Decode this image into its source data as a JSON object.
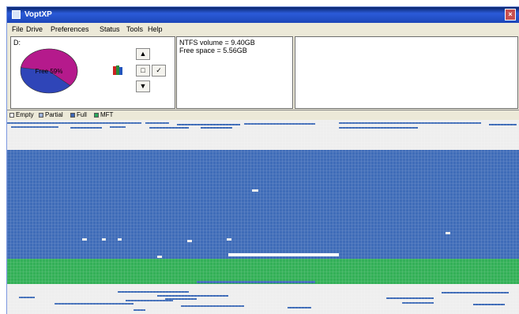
{
  "window": {
    "title": "VoptXP"
  },
  "menu": [
    "File",
    "Drive",
    "Preferences",
    "Status",
    "Tools",
    "Help"
  ],
  "drive": {
    "letter": "D:",
    "pie_label": "Free 59%",
    "free_fraction": 0.59
  },
  "controls": {
    "up_icon": "arrow-up-icon",
    "down_icon": "arrow-down-icon",
    "books_icon": "books-icon",
    "select_icon": "square-icon",
    "check_icon": "checkmark-icon"
  },
  "info": {
    "volume": "NTFS volume = 9.40GB",
    "free": "Free space = 5.56GB"
  },
  "legend": [
    {
      "label": "Empty",
      "color": "#ffffff"
    },
    {
      "label": "Partial",
      "color": "#9fb3d9"
    },
    {
      "label": "Full",
      "color": "#3d67b5"
    },
    {
      "label": "MFT",
      "color": "#28a85a"
    }
  ],
  "colors": {
    "empty": "#eeeeee",
    "full": "#3f6cb8",
    "mft": "#33b057",
    "pie_free": "#b51a8c",
    "pie_used": "#2f45b8"
  }
}
